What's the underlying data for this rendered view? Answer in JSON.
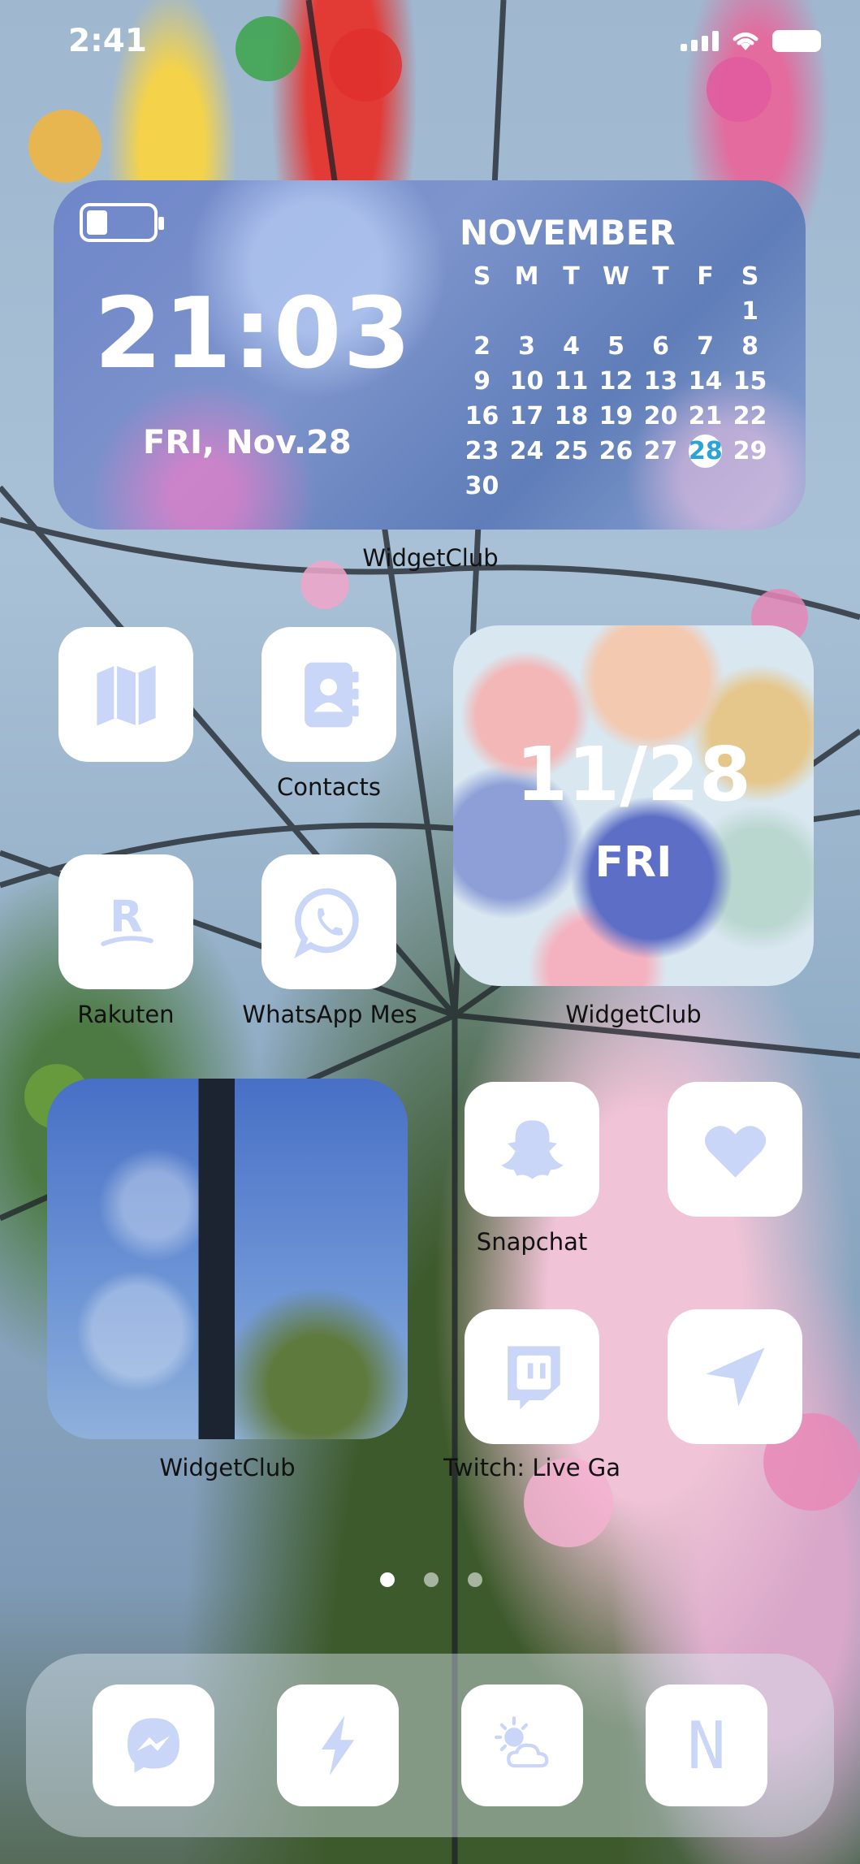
{
  "status_bar": {
    "time": "2:41"
  },
  "calendar_widget": {
    "time": "21:03",
    "date": "FRI, Nov.28",
    "month": "NOVEMBER",
    "weekdays": [
      "S",
      "M",
      "T",
      "W",
      "T",
      "F",
      "S"
    ],
    "days": [
      "",
      "",
      "",
      "",
      "",
      "",
      "1",
      "2",
      "3",
      "4",
      "5",
      "6",
      "7",
      "8",
      "9",
      "10",
      "11",
      "12",
      "13",
      "14",
      "15",
      "16",
      "17",
      "18",
      "19",
      "20",
      "21",
      "22",
      "23",
      "24",
      "25",
      "26",
      "27",
      "28",
      "29",
      "30"
    ],
    "today": "28",
    "label": "WidgetClub"
  },
  "apps": {
    "maps": {
      "label": ""
    },
    "contacts": {
      "label": "Contacts"
    },
    "rakuten": {
      "label": "Rakuten"
    },
    "whatsapp": {
      "label": "WhatsApp Mes"
    },
    "snapchat": {
      "label": "Snapchat"
    },
    "health": {
      "label": ""
    },
    "twitch": {
      "label": "Twitch: Live Ga"
    },
    "location": {
      "label": ""
    }
  },
  "date_widget": {
    "date": "11/28",
    "day": "FRI",
    "label": "WidgetClub"
  },
  "photo_widget": {
    "label": "WidgetClub"
  },
  "page_dots": {
    "count": 3,
    "active": 1
  },
  "dock": {
    "icons": [
      "messenger-icon",
      "bolt-icon",
      "weather-icon",
      "n-icon"
    ],
    "n_letter": "N"
  },
  "colors": {
    "icon_tint": "#c9d6f7",
    "icon_bg": "#ffffff",
    "today_color": "#2ba3d6"
  }
}
